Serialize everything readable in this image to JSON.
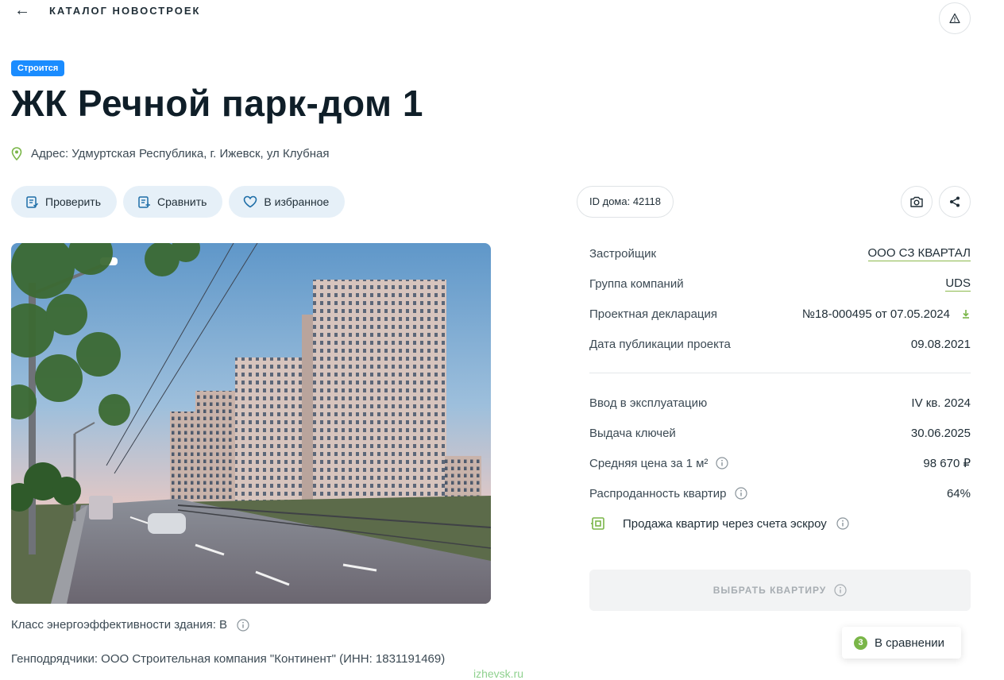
{
  "nav": {
    "back_icon": "arrow-left-icon",
    "catalog_label": "КАТАЛОГ НОВОСТРОЕК",
    "report_icon": "warning-icon"
  },
  "status_badge": "Строится",
  "title": "ЖК Речной парк-дом 1",
  "address": "Адрес: Удмуртская Республика, г. Ижевск, ул Клубная",
  "actions": {
    "check": "Проверить",
    "compare": "Сравнить",
    "favorite": "В избранное"
  },
  "house_id": "ID дома: 42118",
  "info": {
    "developer_label": "Застройщик",
    "developer_value": "ООО СЗ КВАРТАЛ",
    "group_label": "Группа компаний",
    "group_value": "UDS",
    "declaration_label": "Проектная декларация",
    "declaration_value": "№18-000495 от 07.05.2024",
    "published_label": "Дата публикации проекта",
    "published_value": "09.08.2021",
    "commissioning_label": "Ввод в эксплуатацию",
    "commissioning_value": "IV кв. 2024",
    "keys_label": "Выдача ключей",
    "keys_value": "30.06.2025",
    "price_label": "Средняя цена за 1 м²",
    "price_value": "98 670 ₽",
    "sold_label": "Распроданность квартир",
    "sold_value": "64%",
    "escrow_label": "Продажа квартир через счета эскроу"
  },
  "choose_button": "ВЫБРАТЬ КВАРТИРУ",
  "compare_float": {
    "count": "3",
    "label": "В сравнении"
  },
  "energy_class": "Класс энергоэффективности здания: B",
  "contractors": "Генподрядчики: ООО Строительная компания \"Континент\" (ИНН: 1831191469)",
  "watermark": "izhevsk.ru",
  "colors": {
    "accent_green": "#8cb94d",
    "badge_blue": "#1a8cff",
    "pill_bg": "#e6f0f8"
  }
}
